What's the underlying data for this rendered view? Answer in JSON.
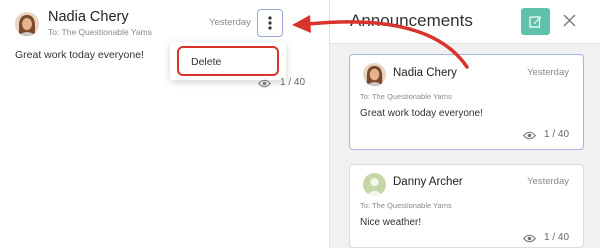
{
  "detail": {
    "author": "Nadia Chery",
    "recipient": "To: The Questionable Yams",
    "time": "Yesterday",
    "message": "Great work today everyone!",
    "views": "1 / 40",
    "menu": {
      "delete_label": "Delete"
    }
  },
  "panel": {
    "title": "Announcements",
    "announcements": [
      {
        "author": "Nadia Chery",
        "recipient": "To: The Questionable Yams",
        "time": "Yesterday",
        "message": "Great work today everyone!",
        "views": "1 / 40"
      },
      {
        "author": "Danny Archer",
        "recipient": "To: The Questionable Yams",
        "time": "Yesterday",
        "message": "Nice weather!",
        "views": "1 / 40"
      }
    ]
  },
  "colors": {
    "accent_green": "#5fc1a9",
    "selected_border": "#a9b4e3",
    "annotation_red": "#d9342b"
  },
  "icons": [
    "more-vertical-icon",
    "eye-icon",
    "compose-icon",
    "close-icon",
    "avatar-photo",
    "avatar-placeholder"
  ]
}
